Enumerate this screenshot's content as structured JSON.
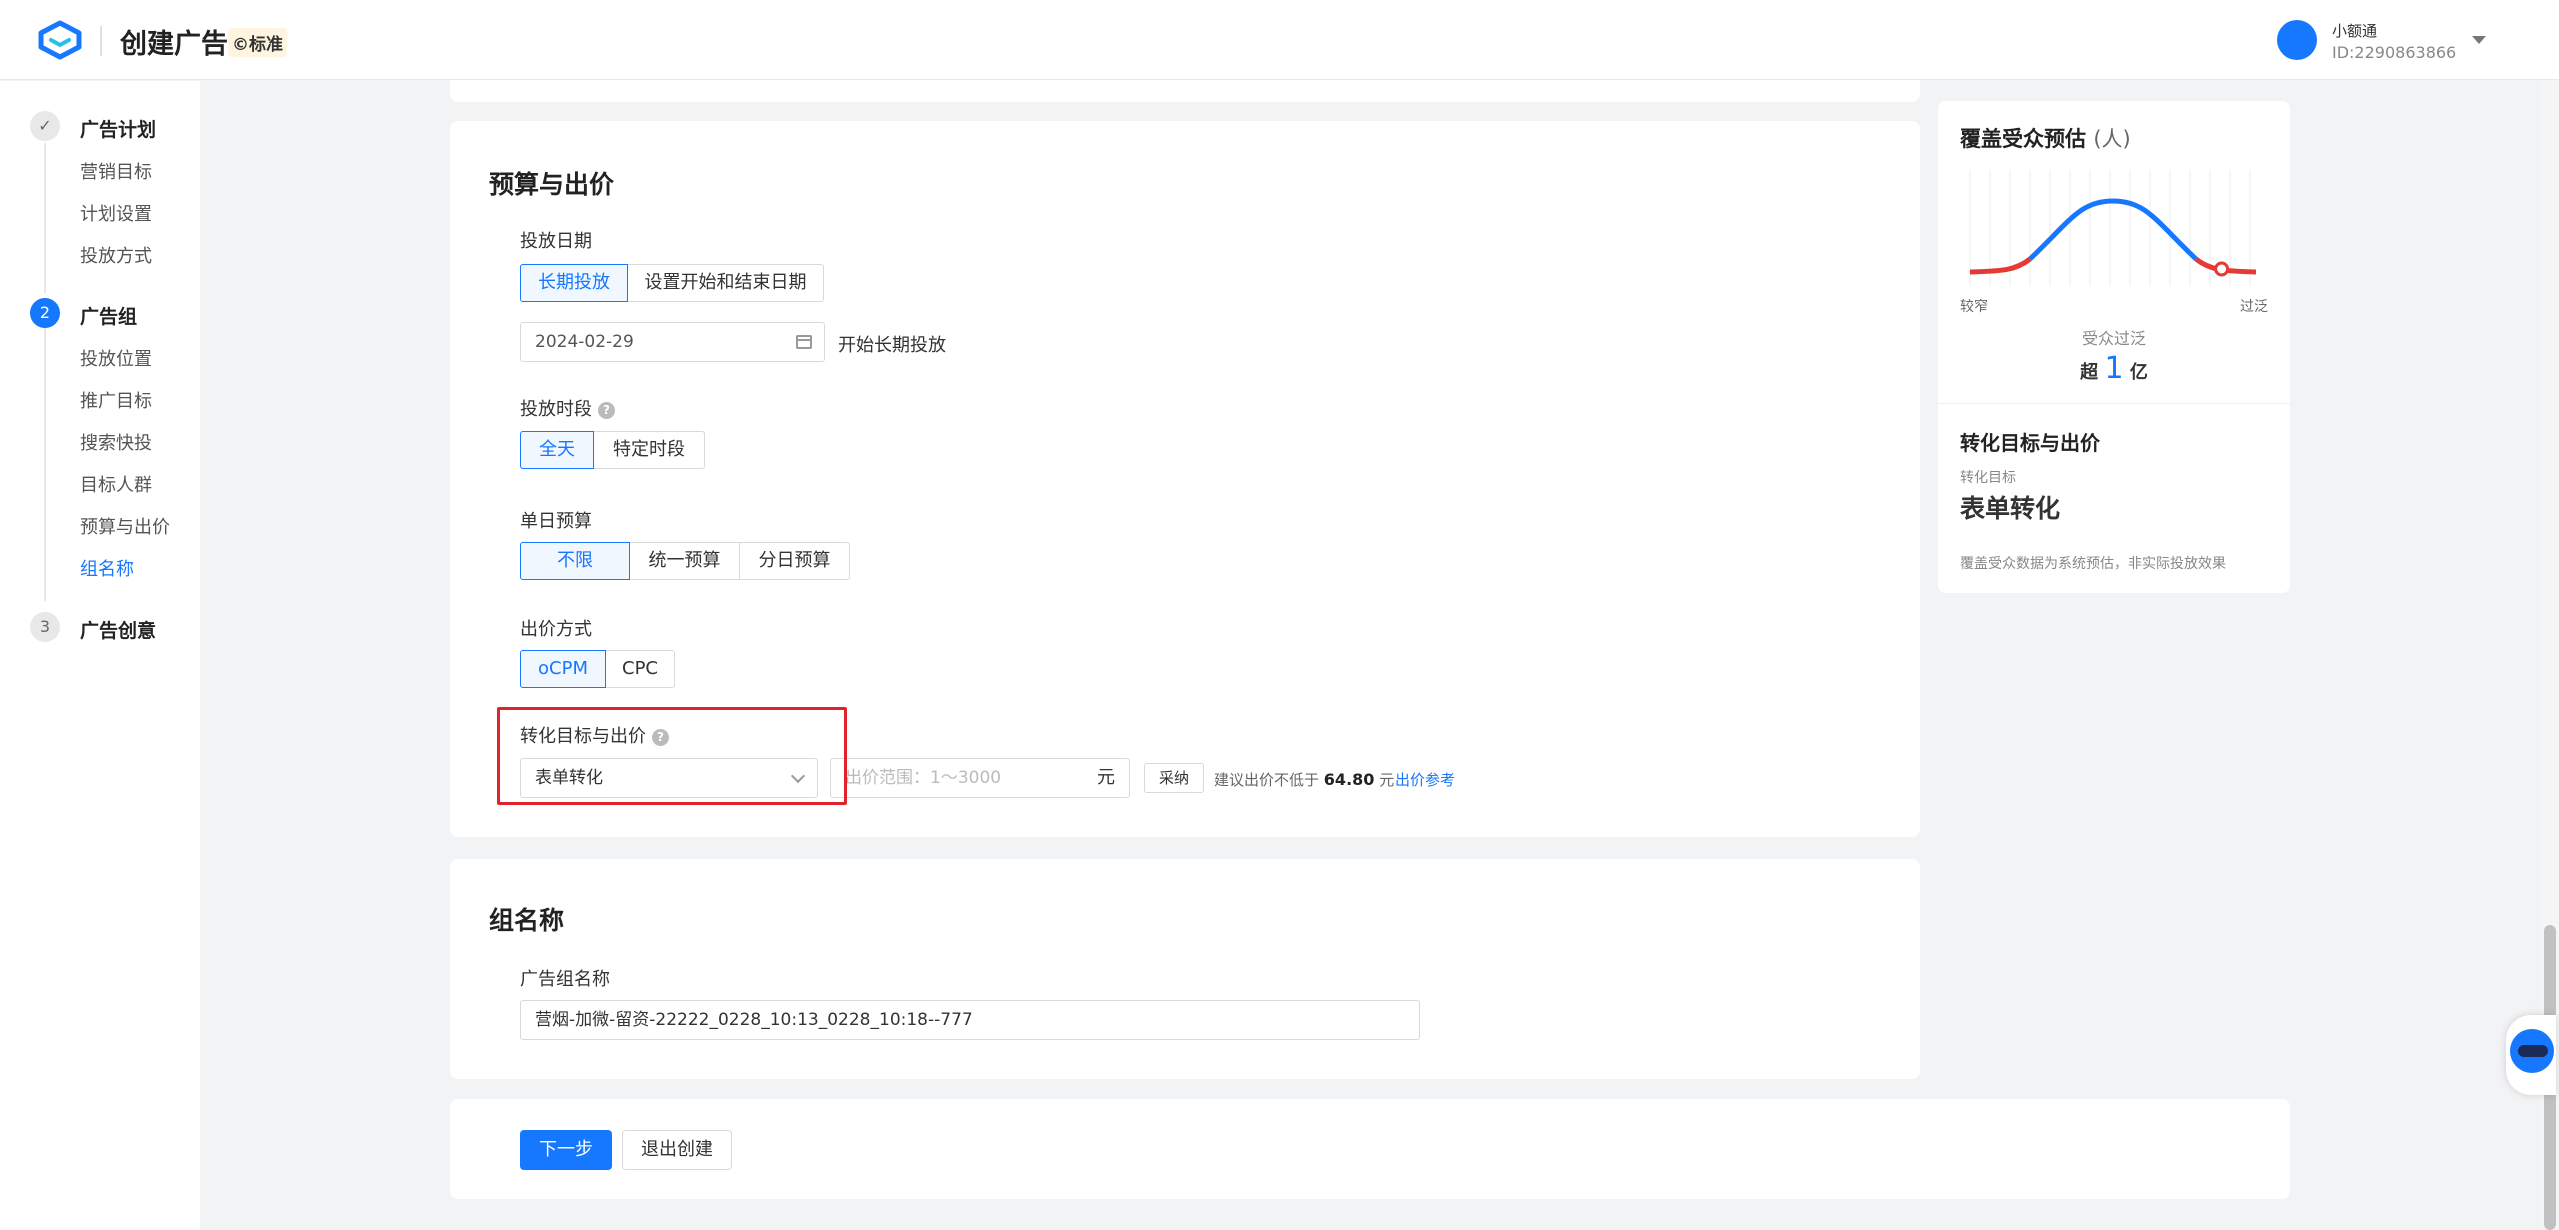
{
  "header": {
    "title": "创建广告",
    "tier_badge": "标准",
    "user_name": "小额通",
    "user_id": "ID:2290863866",
    "logo_icon": "app-logo",
    "user_menu_icon": "chevron-down-icon"
  },
  "leftnav": {
    "steps": [
      {
        "marker": "✓",
        "title": "广告计划",
        "items": [
          "营销目标",
          "计划设置",
          "投放方式"
        ]
      },
      {
        "marker": "2",
        "title": "广告组",
        "items": [
          "投放位置",
          "推广目标",
          "搜索快投",
          "目标人群",
          "预算与出价",
          "组名称"
        ]
      },
      {
        "marker": "3",
        "title": "广告创意",
        "items": []
      }
    ],
    "current_item": "组名称"
  },
  "budget": {
    "title": "预算与出价",
    "schedule_label": "投放日期",
    "schedule_options": [
      "长期投放",
      "设置开始和结束日期"
    ],
    "schedule_selected": "长期投放",
    "start_date": "2024-02-29",
    "start_note": "开始长期投放",
    "time_label": "投放时段",
    "time_options": [
      "全天",
      "特定时段"
    ],
    "time_selected": "全天",
    "daily_label": "单日预算",
    "daily_options": [
      "不限",
      "统一预算",
      "分日预算"
    ],
    "daily_selected": "不限",
    "bid_method_label": "出价方式",
    "bid_method_options": [
      "oCPM",
      "CPC"
    ],
    "bid_method_selected": "oCPM",
    "goal_label": "转化目标与出价",
    "goal_value": "表单转化",
    "bid_placeholder": "出价范围：1～3000",
    "bid_unit": "元",
    "adopt_button": "采纳",
    "suggest_prefix": "建议出价不低于",
    "suggest_value": "64.80",
    "suggest_unit": "元",
    "reference_link": "出价参考"
  },
  "group_name": {
    "title": "组名称",
    "field_label": "广告组名称",
    "value": "营烟-加微-留资-22222_0228_10:13_0228_10:18--777"
  },
  "footer": {
    "next_button": "下一步",
    "exit_button": "退出创建"
  },
  "audience_panel": {
    "title": "覆盖受众预估",
    "title_unit": "(人)",
    "narrow_label": "较窄",
    "wide_label": "过泛",
    "status": "受众过泛",
    "count_prefix": "超",
    "count_value": "1",
    "count_unit": "亿",
    "goal_section_title": "转化目标与出价",
    "goal_label": "转化目标",
    "goal_value": "表单转化",
    "note": "覆盖受众数据为系统预估，非实际投放效果",
    "gauge_level": 0.85
  },
  "colors": {
    "accent": "#1677ff",
    "highlight": "#e0222a",
    "curve_start": "#e53935"
  }
}
